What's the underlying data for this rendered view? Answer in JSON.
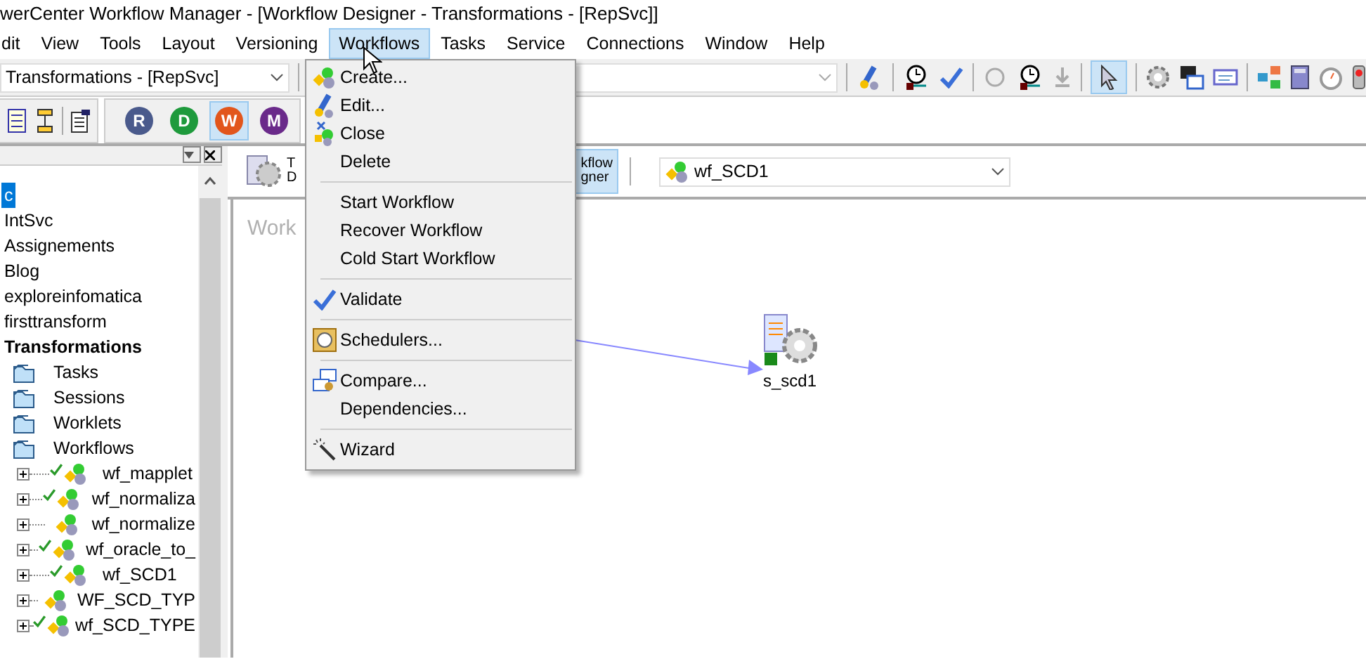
{
  "window": {
    "title": "werCenter Workflow Manager - [Workflow Designer - Transformations - [RepSvc]]"
  },
  "menu_bar": [
    {
      "label": "dit",
      "selected": false
    },
    {
      "label": "View",
      "selected": false
    },
    {
      "label": "Tools",
      "selected": false
    },
    {
      "label": "Layout",
      "selected": false
    },
    {
      "label": "Versioning",
      "selected": false
    },
    {
      "label": "Workflows",
      "selected": true
    },
    {
      "label": "Tasks",
      "selected": false
    },
    {
      "label": "Service",
      "selected": false
    },
    {
      "label": "Connections",
      "selected": false
    },
    {
      "label": "Window",
      "selected": false
    },
    {
      "label": "Help",
      "selected": false
    }
  ],
  "toolbar": {
    "repository_combo": {
      "value": "Transformations - [RepSvc]"
    }
  },
  "tool_buttons": [
    {
      "letter": "R",
      "color": "#4a5a8c",
      "selected": false
    },
    {
      "letter": "D",
      "color": "#1e9a3c",
      "selected": false
    },
    {
      "letter": "W",
      "color": "#e2561c",
      "selected": true
    },
    {
      "letter": "M",
      "color": "#6a2a8a",
      "selected": false
    }
  ],
  "navigator": {
    "items": [
      {
        "label": "c",
        "kind": "repo",
        "selected": true
      },
      {
        "label": "IntSvc",
        "kind": "repo",
        "selected": false
      },
      {
        "label": "Assignements",
        "kind": "repo",
        "selected": false
      },
      {
        "label": "Blog",
        "kind": "repo",
        "selected": false
      },
      {
        "label": "exploreinfomatica",
        "kind": "repo",
        "selected": false
      },
      {
        "label": "firsttransform",
        "kind": "repo",
        "selected": false
      },
      {
        "label": "Transformations",
        "kind": "repo",
        "selected": false,
        "connected": true,
        "children": [
          {
            "label": "Tasks",
            "kind": "folder",
            "selected": false
          },
          {
            "label": "Sessions",
            "kind": "folder",
            "selected": false
          },
          {
            "label": "Worklets",
            "kind": "folder",
            "selected": false
          },
          {
            "label": "Workflows",
            "kind": "folder",
            "selected": false,
            "children": [
              {
                "label": "wf_mapplet",
                "kind": "workflow",
                "valid": true,
                "expanded": false,
                "selected": false
              },
              {
                "label": "wf_normaliza",
                "kind": "workflow",
                "valid": true,
                "expanded": false,
                "selected": false
              },
              {
                "label": "wf_normalize",
                "kind": "workflow",
                "valid": false,
                "expanded": false,
                "selected": false
              },
              {
                "label": "wf_oracle_to_",
                "kind": "workflow",
                "valid": true,
                "expanded": false,
                "selected": false
              },
              {
                "label": "wf_SCD1",
                "kind": "workflow",
                "valid": true,
                "expanded": false,
                "selected": false
              },
              {
                "label": "WF_SCD_TYP",
                "kind": "workflow",
                "valid": false,
                "expanded": false,
                "selected": false
              },
              {
                "label": "wf_SCD_TYPE",
                "kind": "workflow",
                "valid": true,
                "expanded": false,
                "selected": false
              }
            ]
          }
        ]
      }
    ]
  },
  "designer_tabs": [
    {
      "lines": [
        "T",
        "D"
      ],
      "kind": "task",
      "selected": false
    },
    {
      "lines": [
        "kflow",
        "gner"
      ],
      "kind": "workflow",
      "selected": true
    }
  ],
  "workflow_combo": {
    "value": "wf_SCD1"
  },
  "canvas": {
    "label": "Work",
    "nodes": [
      {
        "label": "s_scd1",
        "kind": "session"
      }
    ]
  },
  "workflows_menu": [
    {
      "kind": "create",
      "label": "Create..."
    },
    {
      "kind": "edit",
      "label": "Edit..."
    },
    {
      "kind": "close",
      "label": "Close"
    },
    {
      "kind": "plain",
      "label": "Delete"
    },
    {
      "kind": "separator"
    },
    {
      "kind": "plain",
      "label": "Start Workflow"
    },
    {
      "kind": "plain",
      "label": "Recover Workflow"
    },
    {
      "kind": "plain",
      "label": "Cold Start Workflow"
    },
    {
      "kind": "separator"
    },
    {
      "kind": "validate",
      "label": "Validate"
    },
    {
      "kind": "separator"
    },
    {
      "kind": "scheduler",
      "label": "Schedulers..."
    },
    {
      "kind": "separator"
    },
    {
      "kind": "compare",
      "label": "Compare..."
    },
    {
      "kind": "plain",
      "label": "Dependencies..."
    },
    {
      "kind": "separator"
    },
    {
      "kind": "wizard",
      "label": "Wizard"
    }
  ]
}
